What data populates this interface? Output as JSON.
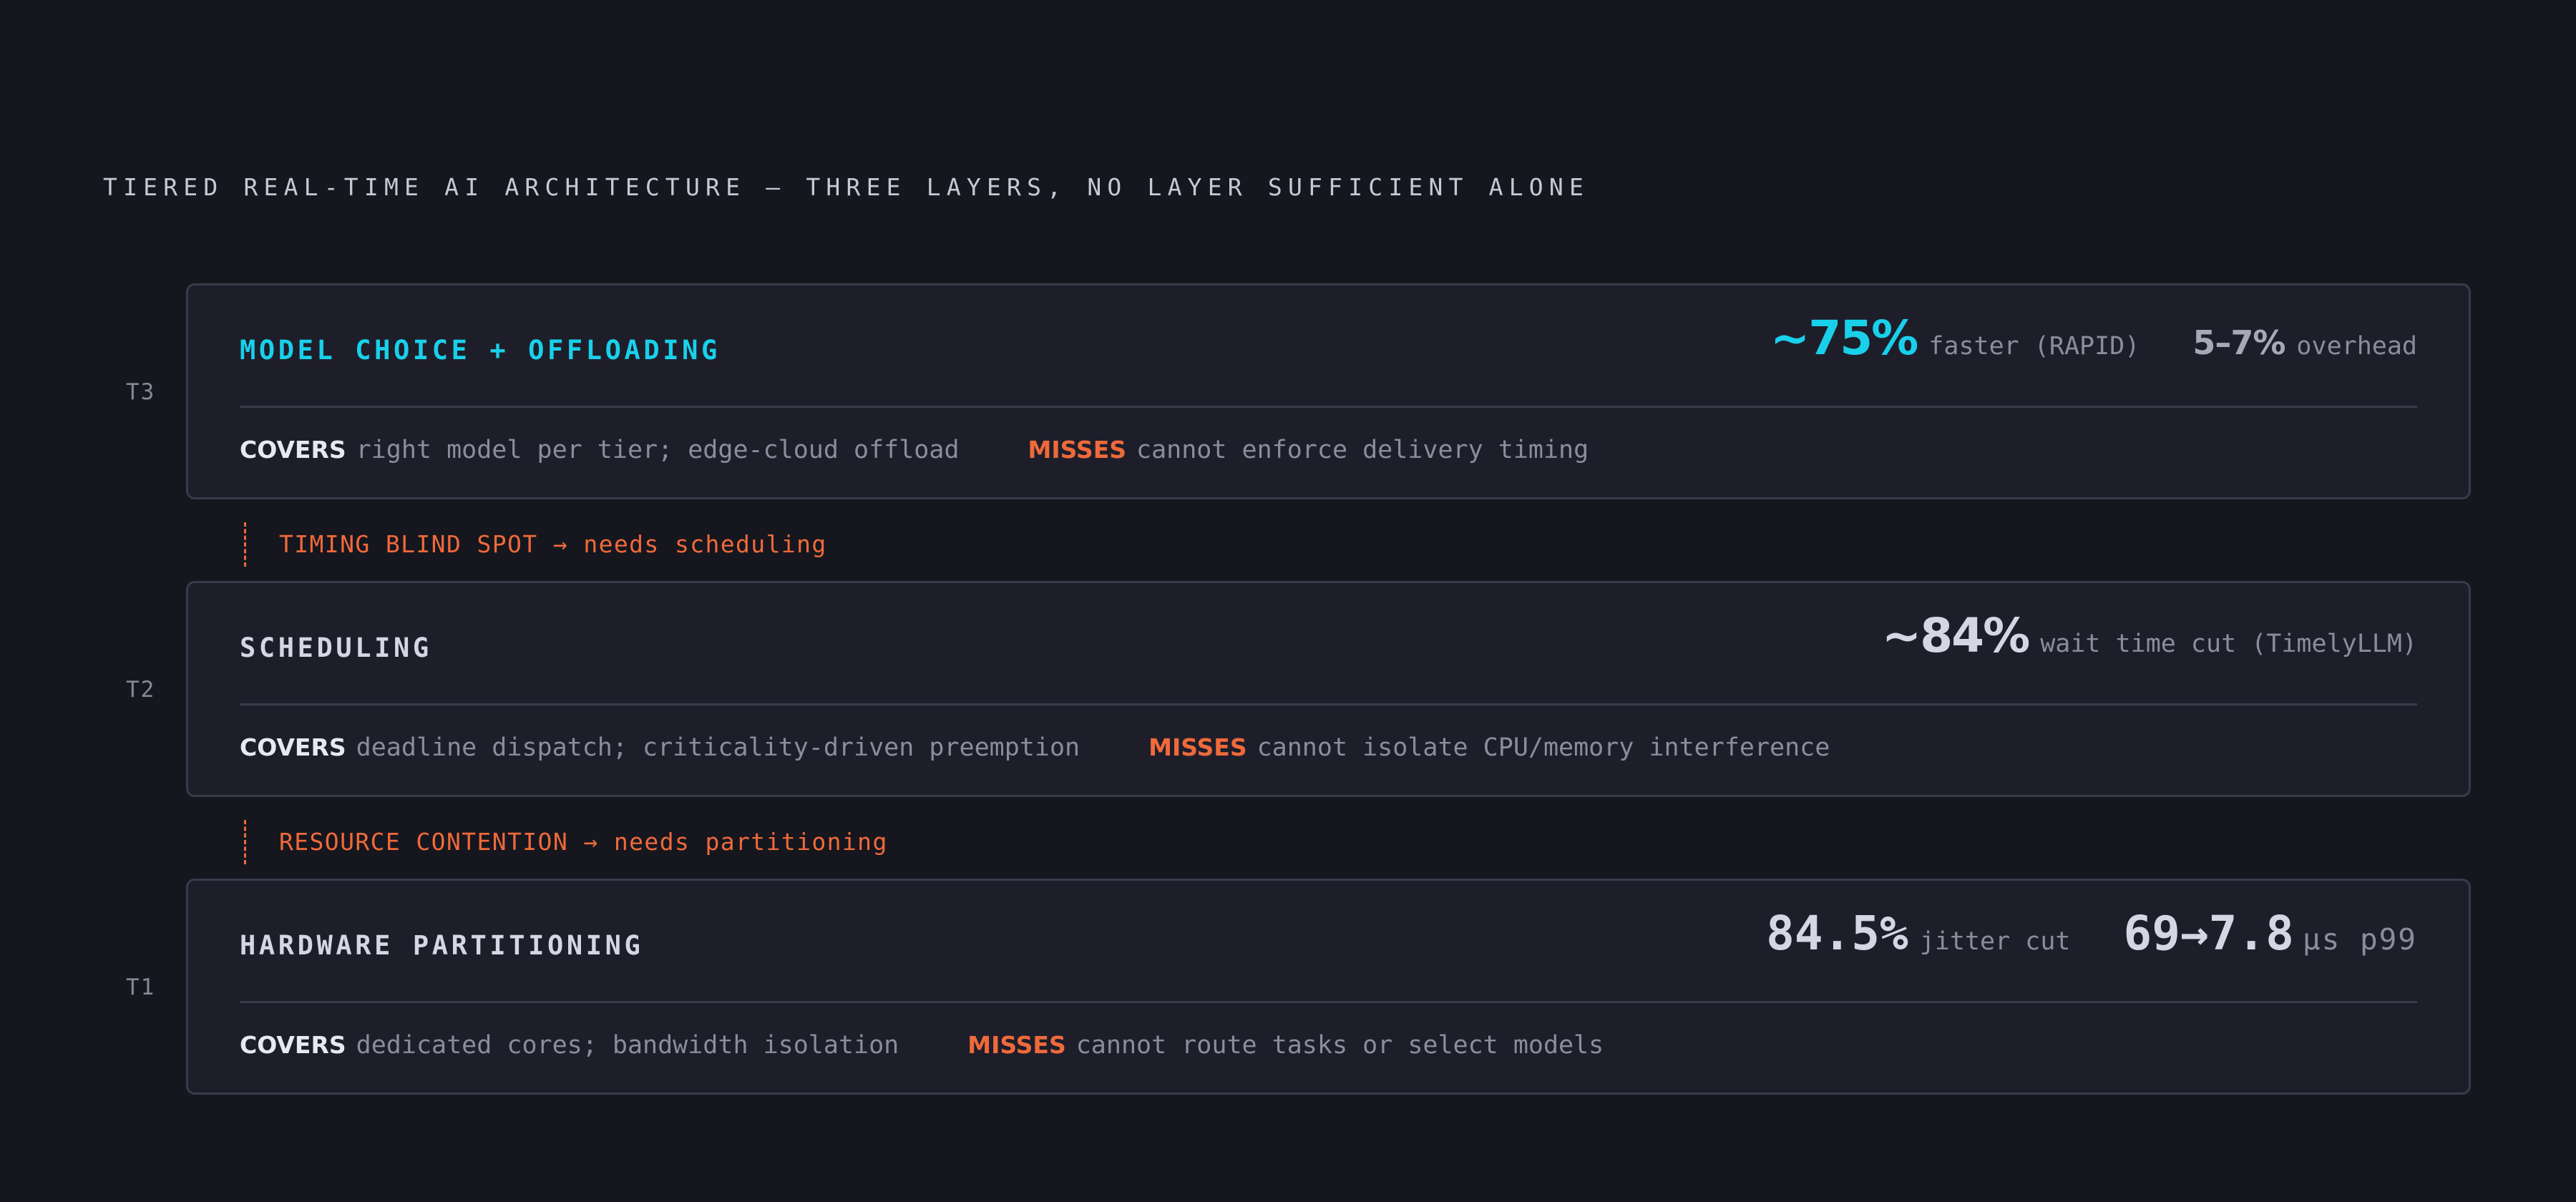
{
  "title": "TIERED REAL-TIME AI ARCHITECTURE — THREE LAYERS, NO LAYER SUFFICIENT ALONE",
  "colors": {
    "background": "#16161e",
    "card": "#1e1e2a",
    "border": "#3a3b4b",
    "accent_cyan": "#19d0ea",
    "accent_orange": "#ef6a3a"
  },
  "tiers": [
    {
      "label": "T3",
      "title": "MODEL CHOICE + OFFLOADING",
      "metrics": [
        {
          "value": "~75%",
          "caption": "faster (RAPID)"
        },
        {
          "value": "5–7%",
          "caption": "overhead"
        }
      ],
      "covers_label": "COVERS",
      "covers": "right model per tier; edge-cloud offload",
      "misses_label": "MISSES",
      "misses": "cannot enforce delivery timing"
    },
    {
      "label": "T2",
      "title": "SCHEDULING",
      "metrics": [
        {
          "value": "~84%",
          "caption": "wait time cut (TimelyLLM)"
        }
      ],
      "covers_label": "COVERS",
      "covers": "deadline dispatch; criticality-driven preemption",
      "misses_label": "MISSES",
      "misses": "cannot isolate CPU/memory interference"
    },
    {
      "label": "T1",
      "title": "HARDWARE PARTITIONING",
      "metrics": [
        {
          "value": "84.5%",
          "caption": "jitter cut"
        },
        {
          "value": "69→7.8",
          "caption": "µs p99"
        }
      ],
      "covers_label": "COVERS",
      "covers": "dedicated cores; bandwidth isolation",
      "misses_label": "MISSES",
      "misses": "cannot route tasks or select models"
    }
  ],
  "connectors": [
    "TIMING BLIND SPOT → needs scheduling",
    "RESOURCE CONTENTION → needs partitioning"
  ]
}
